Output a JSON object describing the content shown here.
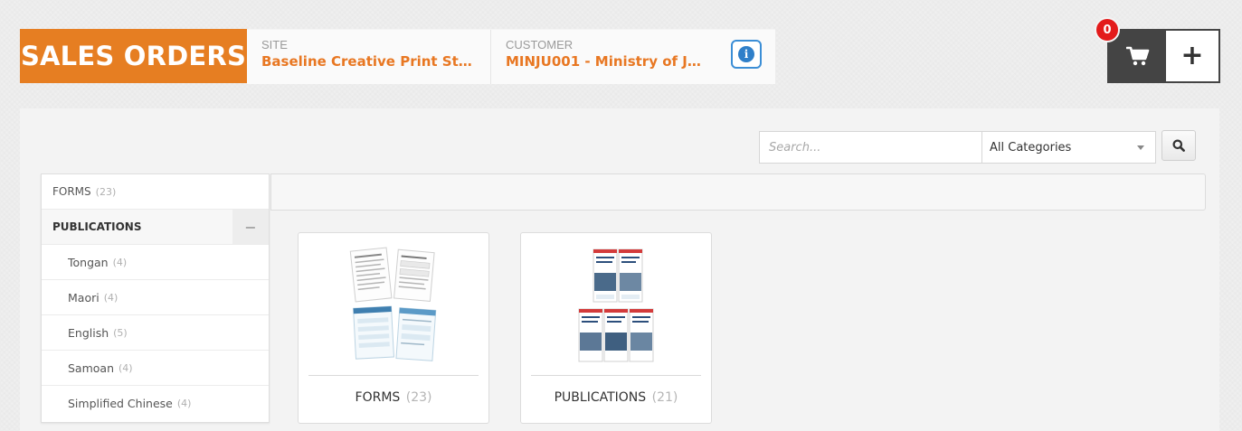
{
  "header": {
    "brand_title": "SALES ORDERS",
    "site_label": "SITE",
    "site_value": "Baseline Creative Print Studi...",
    "customer_label": "CUSTOMER",
    "customer_value": "MINJU001 - Ministry of Justice",
    "info_glyph": "i",
    "cart_count": "0",
    "plus_label": "+"
  },
  "search": {
    "placeholder": "Search...",
    "category_selected": "All Categories"
  },
  "sidebar": {
    "items": [
      {
        "label": "FORMS",
        "count": "(23)"
      },
      {
        "label": "PUBLICATIONS",
        "count": ""
      },
      {
        "label": "Tongan",
        "count": "(4)"
      },
      {
        "label": "Maori",
        "count": "(4)"
      },
      {
        "label": "English",
        "count": "(5)"
      },
      {
        "label": "Samoan",
        "count": "(4)"
      },
      {
        "label": "Simplified Chinese",
        "count": "(4)"
      }
    ],
    "collapse_glyph": "−"
  },
  "products": [
    {
      "title": "FORMS",
      "count": "(23)"
    },
    {
      "title": "PUBLICATIONS",
      "count": "(21)"
    }
  ],
  "colors": {
    "brand_orange": "#e67e22",
    "accent_orange": "#e87722",
    "info_blue": "#2f7fc9",
    "cart_dark": "#444444",
    "badge_red": "#e31b1b"
  },
  "icons": {
    "cart": "shopping-cart-icon",
    "search": "magnifier-icon",
    "info": "info-circle-icon",
    "collapse": "minus-icon"
  }
}
